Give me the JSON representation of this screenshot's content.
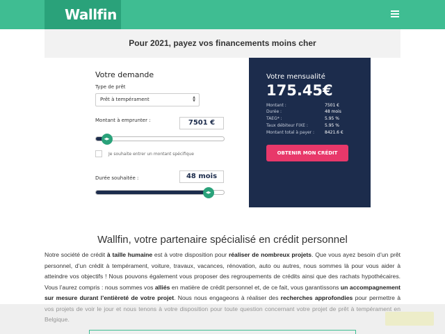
{
  "header": {
    "logo": "Wallfin",
    "menu_icon": "hamburger-menu-icon"
  },
  "promo": {
    "text": "Pour 2021, payez vos financements moins cher"
  },
  "form": {
    "title": "Votre demande",
    "loan_type_label": "Type de prêt",
    "loan_type_value": "Prêt à tempérament",
    "amount_label": "Montant à emprunter :",
    "amount_value": "7501 €",
    "amount_slider_fraction": 0.05,
    "specific_amount_label": "Je souhaite entrer un montant spécifique",
    "specific_amount_checked": false,
    "duration_label": "Durée souhaitée :",
    "duration_value": "48 mois",
    "duration_slider_fraction": 0.91
  },
  "summary": {
    "title": "Votre mensualité",
    "monthly": "175.45€",
    "rows": [
      {
        "key": "Montant :",
        "value": "7501 €"
      },
      {
        "key": "Durée :",
        "value": "48 mois"
      },
      {
        "key": "TAEG* :",
        "value": "5.95 %"
      },
      {
        "key": "Taux débiteur FIXE :",
        "value": "5.95 %"
      },
      {
        "key": "Montant total à payer :",
        "value": "8421.6 €"
      }
    ],
    "cta": "OBTENIR MON CRÉDIT"
  },
  "article": {
    "heading": "Wallfin, votre partenaire spécialisé en crédit personnel",
    "p_parts": [
      "Notre société de crédit ",
      "à taille humaine",
      " est à votre disposition pour ",
      "réaliser de nombreux projets",
      ". Que vous ayez besoin d’un prêt personnel, d’un crédit à tempérament, voiture, travaux, vacances, rénovation, auto ou autres, nous sommes là pour vous aider à atteindre vos objectifs ! Nous pouvons également vous proposer des regroupements de crédits ainsi que des rachats hypothécaires. Vous l’aurez compris : nous sommes vos ",
      "alliés",
      " en matière de crédit personnel et, de ce fait, vous garantissons ",
      "un accompagnement sur mesure durant l’entièreté de votre projet",
      ". Nous nous engageons à réaliser des ",
      "recherches approfondies",
      " pour permettre à vos projets de voir le jour et nous tenons à votre disposition pour toute question concernant votre projet de prêt à tempérament en Belgique."
    ]
  },
  "colors": {
    "brand_green": "#3fbd92",
    "navy": "#1c2c4c",
    "cta_pink": "#e8386a"
  }
}
